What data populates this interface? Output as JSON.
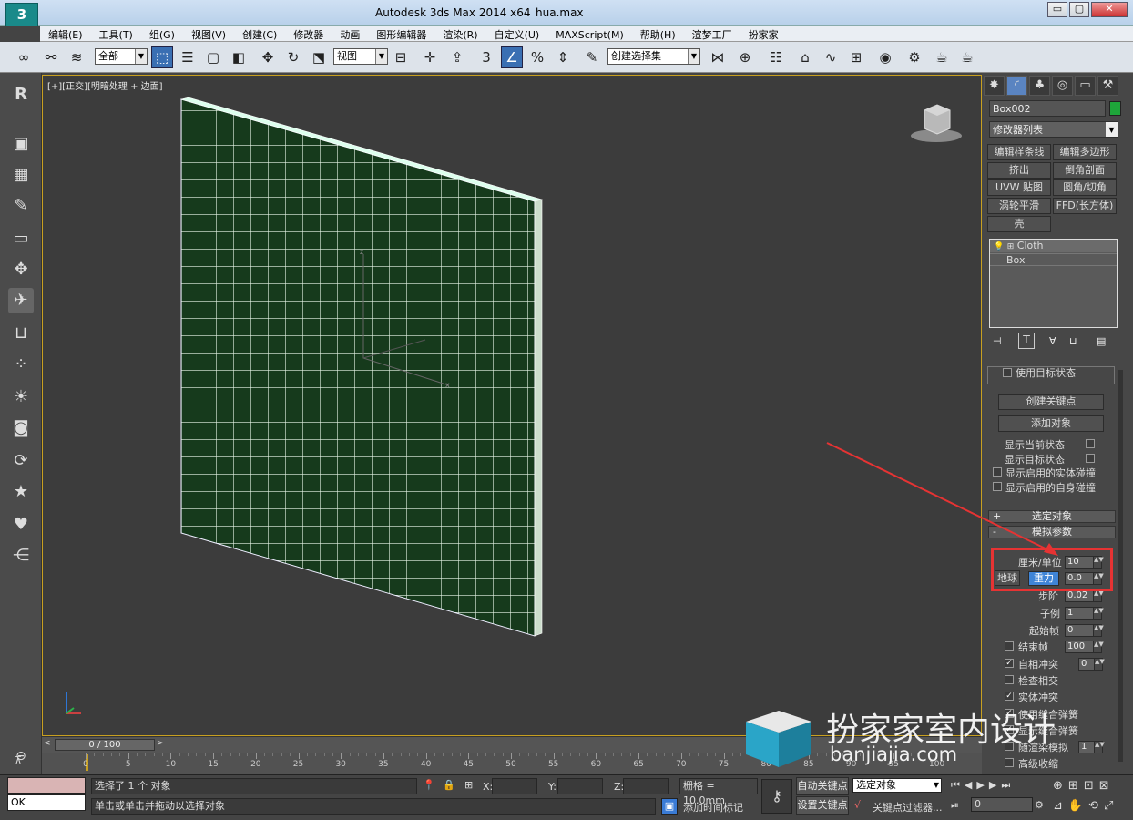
{
  "titlebar": {
    "app": "Autodesk 3ds Max  2014 x64",
    "file": "hua.max",
    "min": "▭",
    "max": "▢",
    "close": "✕"
  },
  "menu": [
    "编辑(E)",
    "工具(T)",
    "组(G)",
    "视图(V)",
    "创建(C)",
    "修改器",
    "动画",
    "图形编辑器",
    "渲染(R)",
    "自定义(U)",
    "MAXScript(M)",
    "帮助(H)",
    "渲梦工厂",
    "扮家家"
  ],
  "toolbar": {
    "filter": "全部",
    "refcoord": "视图",
    "selset": "创建选择集"
  },
  "viewport": {
    "label": "[+][正交][明暗处理 + 边面]",
    "axis_x": "x",
    "axis_z": "z"
  },
  "cmdpanel": {
    "object_name": "Box002",
    "object_color": "#1ea63a",
    "modifier_list": "修改器列表",
    "modifier_buttons": [
      "编辑样条线",
      "编辑多边形",
      "挤出",
      "倒角剖面",
      "UVW 贴图",
      "圆角/切角",
      "涡轮平滑",
      "FFD(长方体)",
      "壳"
    ],
    "stack": [
      "Cloth",
      "Box"
    ],
    "use_target_state": "使用目标状态",
    "create_keys": "创建关键点",
    "add_objects": "添加对象",
    "show_current": "显示当前状态",
    "show_target": "显示目标状态",
    "show_solid_coll": "显示启用的实体碰撞",
    "show_self_coll": "显示启用的自身碰撞",
    "roll_selected": "选定对象",
    "roll_sim": "模拟参数",
    "cm_unit_label": "厘米/单位",
    "cm_unit_value": "10",
    "earth": "地球",
    "gravity": "重力",
    "gravity_value": "0.0",
    "step_label": "步阶",
    "step_value": "0.02",
    "subsample_label": "子例",
    "subsample_value": "1",
    "start_label": "起始帧",
    "start_value": "0",
    "end_label": "结束帧",
    "end_value": "100",
    "self_coll_label": "自相冲突",
    "self_coll_value": "0",
    "check_inter": "检查相交",
    "solid_coll": "实体冲突",
    "use_sew": "使用缝合弹簧",
    "show_sew": "显示缝合弹簧",
    "render_sim": "随渲染模拟",
    "render_sim_value": "1",
    "adv_pinch": "高级收缩"
  },
  "timeline": {
    "frame": "0 / 100",
    "ticks": [
      "0",
      "5",
      "10",
      "15",
      "20",
      "25",
      "30",
      "35",
      "40",
      "45",
      "50",
      "55",
      "60",
      "65",
      "70",
      "75",
      "80",
      "85",
      "90",
      "95",
      "100"
    ]
  },
  "status": {
    "maxscript": "OK",
    "selected": "选择了 1 个 对象",
    "prompt": "单击或单击并拖动以选择对象",
    "x_label": "X:",
    "y_label": "Y:",
    "z_label": "Z:",
    "grid": "栅格 = 10.0mm",
    "auto_key": "自动关键点",
    "set_key": "设置关键点",
    "sel_mode": "选定对象",
    "key_filters": "关键点过滤器...",
    "add_time_tag": "添加时间标记",
    "frame": "0"
  },
  "watermark": {
    "cn": "扮家家室内设计",
    "url": "banjiajia.com"
  }
}
